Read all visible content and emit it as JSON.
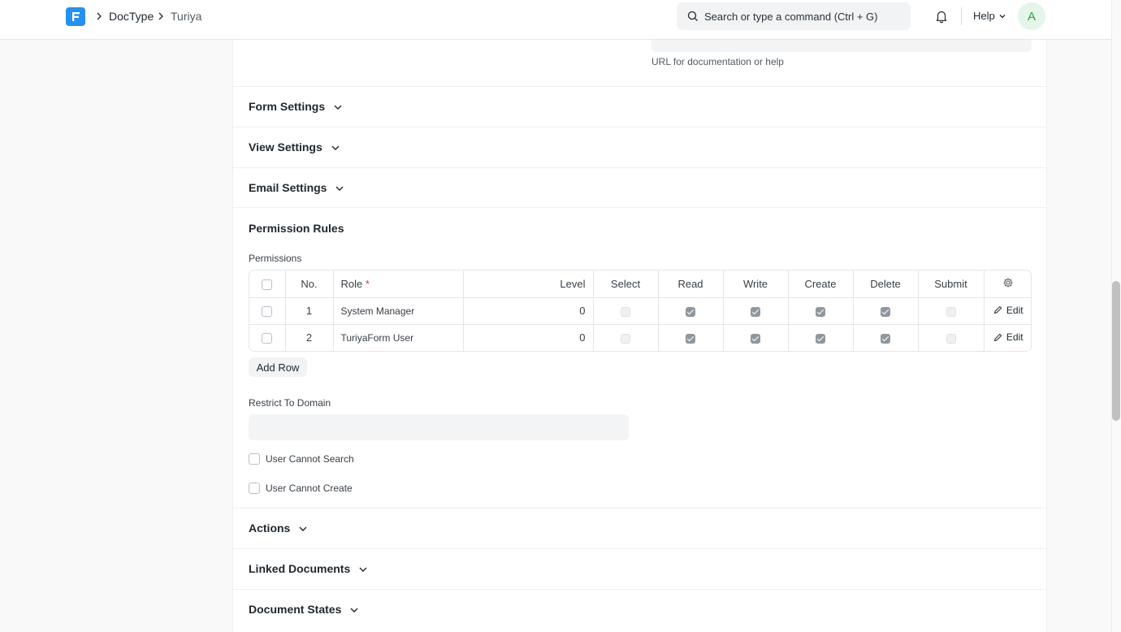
{
  "navbar": {
    "breadcrumbs": [
      "DocType",
      "Turiya"
    ],
    "search_placeholder": "Search or type a command (Ctrl + G)",
    "help_label": "Help",
    "avatar_initial": "A"
  },
  "form": {
    "url_help_text": "URL for documentation or help",
    "sections": {
      "form_settings": "Form Settings",
      "view_settings": "View Settings",
      "email_settings": "Email Settings",
      "permission_rules": "Permission Rules",
      "actions": "Actions",
      "linked_documents": "Linked Documents",
      "document_states": "Document States"
    },
    "permissions": {
      "label": "Permissions",
      "columns": {
        "no": "No.",
        "role": "Role",
        "role_required": "*",
        "level": "Level",
        "select": "Select",
        "read": "Read",
        "write": "Write",
        "create": "Create",
        "delete": "Delete",
        "submit": "Submit"
      },
      "rows": [
        {
          "no": "1",
          "role": "System Manager",
          "level": "0",
          "select": false,
          "read": true,
          "write": true,
          "create": true,
          "delete": true,
          "submit": false,
          "edit_label": "Edit"
        },
        {
          "no": "2",
          "role": "TuriyaForm User",
          "level": "0",
          "select": false,
          "read": true,
          "write": true,
          "create": true,
          "delete": true,
          "submit": false,
          "edit_label": "Edit"
        }
      ],
      "add_row_label": "Add Row"
    },
    "restrict_to_domain": {
      "label": "Restrict To Domain",
      "value": ""
    },
    "user_cannot_search": {
      "label": "User Cannot Search",
      "checked": false
    },
    "user_cannot_create": {
      "label": "User Cannot Create",
      "checked": false
    }
  }
}
